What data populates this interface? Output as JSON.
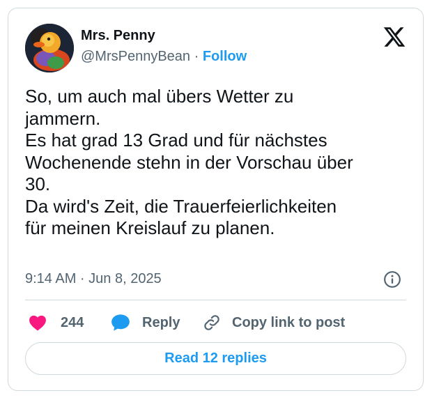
{
  "author": {
    "name": "Mrs. Penny",
    "handle": "@MrsPennyBean",
    "separator": "·",
    "follow_label": "Follow",
    "avatar_icon": "rubber-duck-avatar"
  },
  "tweet": {
    "text": "So, um auch mal übers Wetter zu\njammern.\nEs hat grad 13 Grad und für nächstes\nWochenende stehn in der Vorschau über\n30.\nDa wird's Zeit, die Trauerfeierlichkeiten\nfür meinen Kreislauf zu planen.",
    "timestamp": "9:14 AM · Jun 8, 2025"
  },
  "actions": {
    "likes_count": "244",
    "reply_label": "Reply",
    "copy_link_label": "Copy link to post"
  },
  "footer": {
    "read_replies_label": "Read 12 replies"
  },
  "colors": {
    "accent": "#1d9bf0",
    "like": "#f91880",
    "text": "#0f1419",
    "muted": "#536471",
    "border": "#cfd9de"
  }
}
